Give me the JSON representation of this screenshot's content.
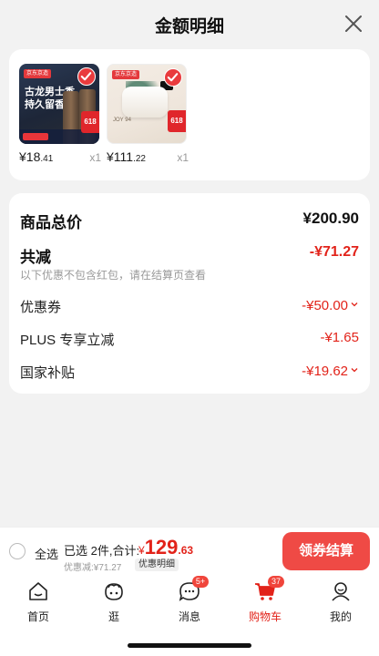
{
  "header": {
    "title": "金额明细",
    "close_icon": "close-icon"
  },
  "products": [
    {
      "name": "古龙男士香 持久留香",
      "thumb_line1": "古龙男士香",
      "thumb_line2": "持久留香",
      "brand": "京东京造",
      "promo_tag": "618",
      "price_int": "¥18",
      "price_dec": ".41",
      "qty": "x1",
      "checked": true
    },
    {
      "name": "JOY 乳胶枕",
      "brand": "京东京造",
      "thumb_text": "JOY 94",
      "promo_tag": "618",
      "price_int": "¥111",
      "price_dec": ".22",
      "qty": "x1",
      "checked": true
    }
  ],
  "summary": {
    "total_label": "商品总价",
    "total_value": "¥200.90",
    "discount_label": "共减",
    "discount_value": "-¥71.27",
    "note": "以下优惠不包含红包，请在结算页查看",
    "coupon_label": "优惠券",
    "coupon_value": "-¥50.00",
    "plus_label": "PLUS 专享立减",
    "plus_value": "-¥1.65",
    "subsidy_label": "国家补贴",
    "subsidy_value": "-¥19.62"
  },
  "checkout": {
    "select_all": "全选",
    "selected_info": "已选 2件,合计:",
    "currency": "¥",
    "price_int": "129",
    "price_dec": ".63",
    "discount_line": "优惠减:¥71.27",
    "detail_label": "优惠明细",
    "button_label": "领券结算"
  },
  "tabbar": [
    {
      "label": "首页",
      "icon": "home-icon"
    },
    {
      "label": "逛",
      "icon": "stroll-face-icon"
    },
    {
      "label": "消息",
      "icon": "message-icon",
      "badge": "5+"
    },
    {
      "label": "购物车",
      "icon": "cart-icon",
      "badge": "37",
      "active": true
    },
    {
      "label": "我的",
      "icon": "profile-icon"
    }
  ],
  "colors": {
    "accent": "#e2231a",
    "button": "#ef4a45",
    "background": "#f2f2f2"
  }
}
